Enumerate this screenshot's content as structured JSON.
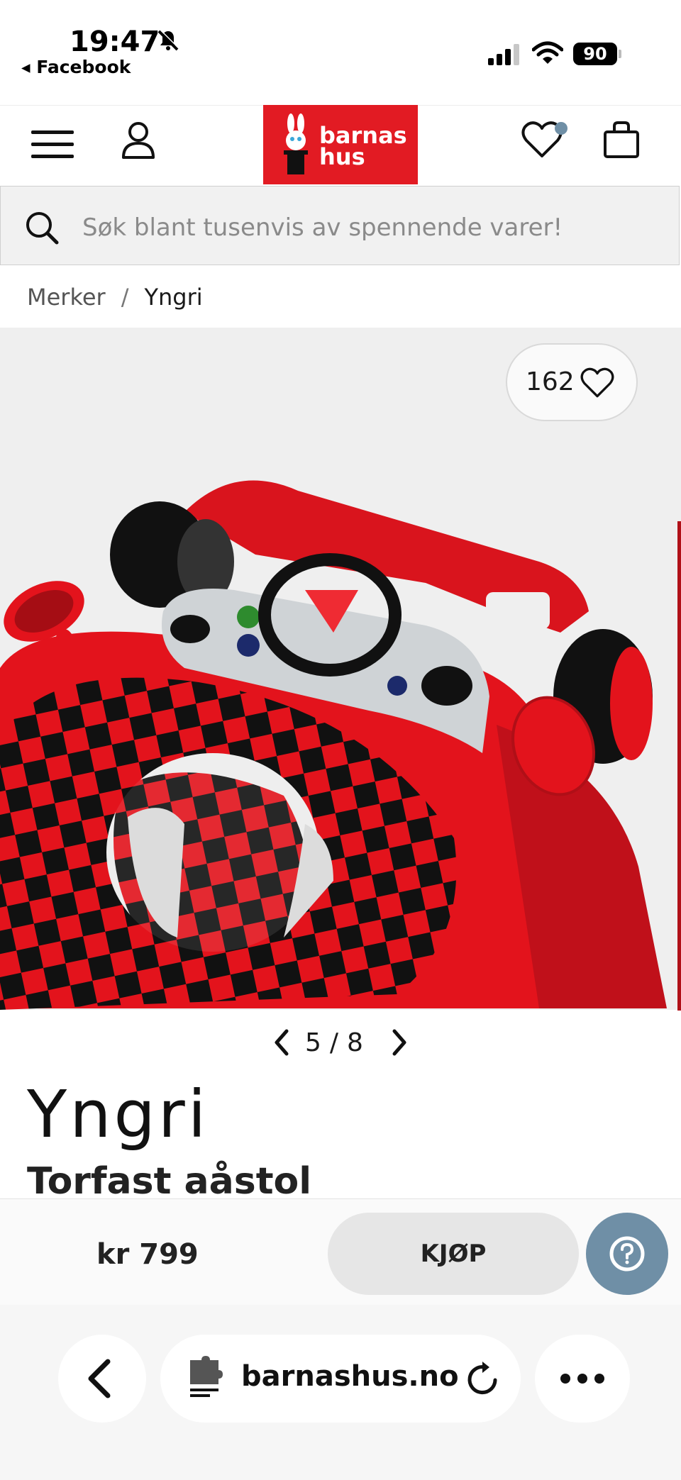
{
  "status_bar": {
    "time": "19:47",
    "back_app": "◂ Facebook",
    "battery": "90"
  },
  "header": {
    "logo_text_line1": "barnas",
    "logo_text_line2": "hus",
    "brand_color": "#e21b23"
  },
  "search": {
    "placeholder": "Søk blant tusenvis av spennende varer!"
  },
  "breadcrumb": {
    "items": [
      "Merker",
      "Yngri"
    ],
    "separator": "/"
  },
  "gallery": {
    "like_count": "162",
    "current": "5",
    "separator": "/",
    "total": "8"
  },
  "product": {
    "brand": "Yngri",
    "title": "Torfast aåstol",
    "price": "kr 799",
    "buy_label": "KJØP"
  },
  "browser": {
    "url": "barnashus.no"
  },
  "colors": {
    "accent": "#6f8fa6",
    "logo_red": "#e21b23",
    "product_red": "#e3131c"
  }
}
